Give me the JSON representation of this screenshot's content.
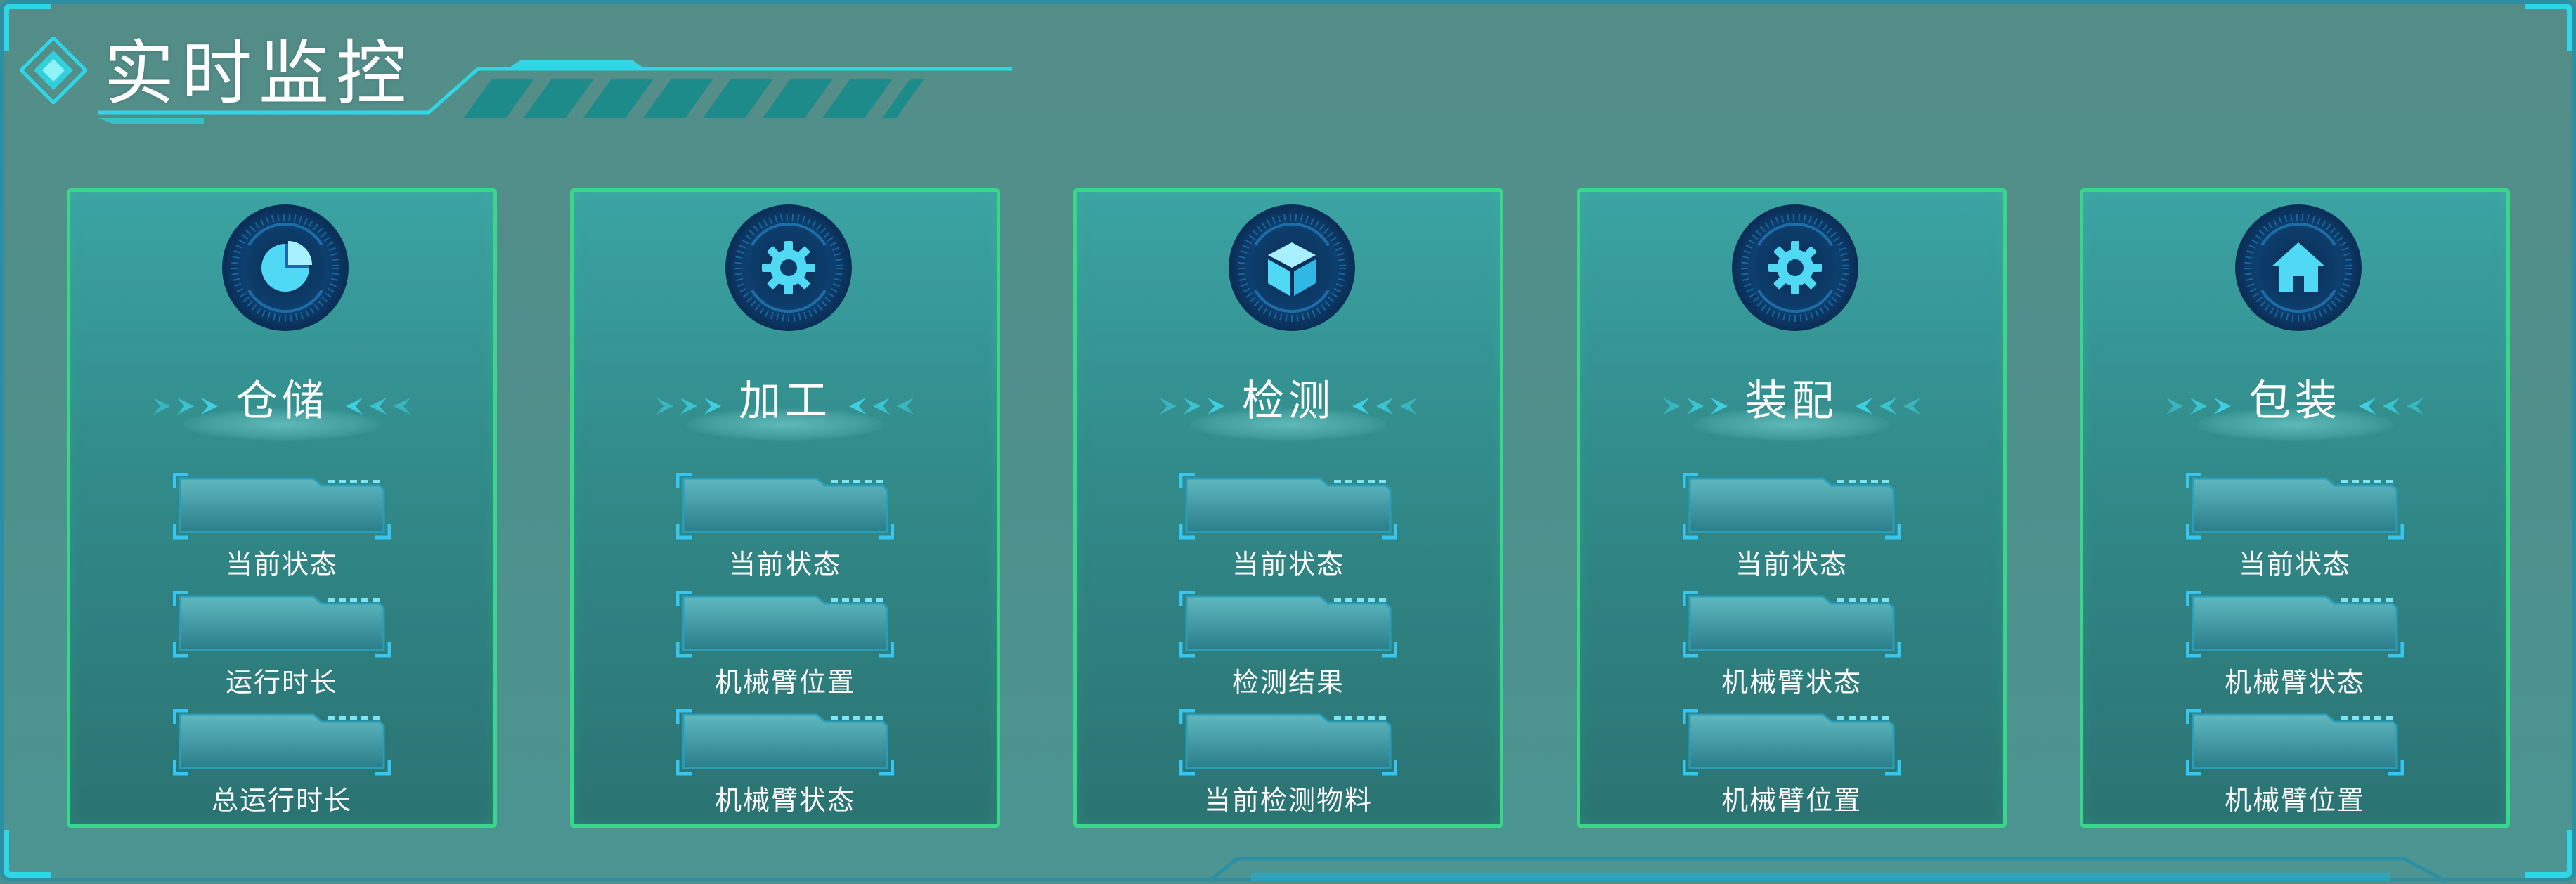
{
  "page": {
    "title": "实时监控"
  },
  "colors": {
    "background": "#4f8f8c",
    "card_border": "#3ad78a",
    "accent_cyan": "#2fd7e6",
    "field_border": "#38c6f0"
  },
  "stations": [
    {
      "name": "仓储",
      "icon": "pie-chart-icon",
      "fields": [
        {
          "label": "当前状态",
          "value": ""
        },
        {
          "label": "运行时长",
          "value": ""
        },
        {
          "label": "总运行时长",
          "value": ""
        }
      ]
    },
    {
      "name": "加工",
      "icon": "gear-icon",
      "fields": [
        {
          "label": "当前状态",
          "value": ""
        },
        {
          "label": "机械臂位置",
          "value": ""
        },
        {
          "label": "机械臂状态",
          "value": ""
        }
      ]
    },
    {
      "name": "检测",
      "icon": "cube-icon",
      "fields": [
        {
          "label": "当前状态",
          "value": ""
        },
        {
          "label": "检测结果",
          "value": ""
        },
        {
          "label": "当前检测物料",
          "value": ""
        }
      ]
    },
    {
      "name": "装配",
      "icon": "gear-icon",
      "fields": [
        {
          "label": "当前状态",
          "value": ""
        },
        {
          "label": "机械臂状态",
          "value": ""
        },
        {
          "label": "机械臂位置",
          "value": ""
        }
      ]
    },
    {
      "name": "包装",
      "icon": "home-icon",
      "fields": [
        {
          "label": "当前状态",
          "value": ""
        },
        {
          "label": "机械臂状态",
          "value": ""
        },
        {
          "label": "机械臂位置",
          "value": ""
        }
      ]
    }
  ]
}
